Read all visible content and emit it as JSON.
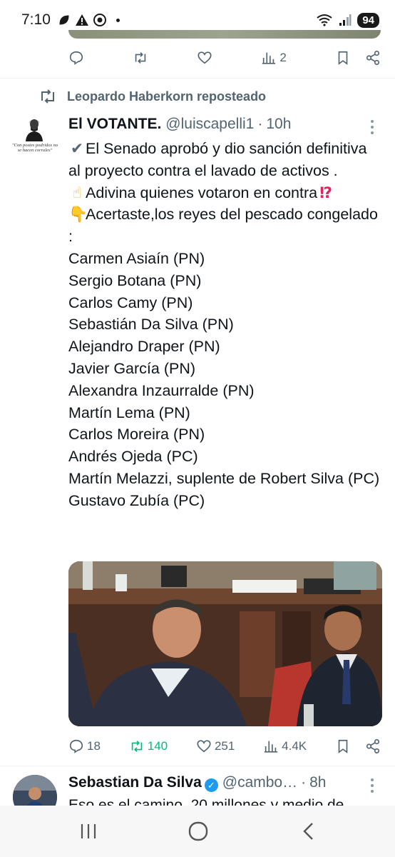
{
  "status_bar": {
    "time": "7:10",
    "battery": "94"
  },
  "prev_tweet_actions": {
    "views": "2"
  },
  "repost": {
    "label": "Leopardo Haberkorn reposteado"
  },
  "avatar_caption": "\"Con postes podridos no se hacen corrales\"",
  "tweet": {
    "author": "El VOTANTE.",
    "handle": "@luiscapelli1",
    "separator": "·",
    "time": "10h",
    "line1_emoji": "✔",
    "line1": "El Senado aprobó y dio sanción definitiva al proyecto contra el lavado de activos .",
    "line2_emoji": "☝",
    "line2": "Adivina quienes votaron en contra",
    "line2_end_emoji": "⁉",
    "line3_emoji": "👇",
    "line3": "Acertaste,los reyes del pescado congelado :",
    "names": [
      "Carmen Asiaín (PN)",
      "Sergio Botana (PN)",
      "Carlos Camy (PN)",
      "Sebastián Da Silva (PN)",
      "Alejandro Draper (PN)",
      "Javier García (PN)",
      "Alexandra Inzaurralde (PN)",
      "Martín Lema (PN)",
      "Carlos Moreira (PN)",
      "Andrés Ojeda (PC)",
      "Martín Melazzi, suplente de Robert Silva (PC)",
      "Gustavo Zubía (PC)"
    ],
    "actions": {
      "replies": "18",
      "reposts": "140",
      "likes": "251",
      "views": "4.4K"
    }
  },
  "next_tweet": {
    "author": "Sebastian Da Silva",
    "handle": "@cambo…",
    "separator": "·",
    "time": "8h",
    "text_cut": "Eso es el camino. 20 millones y medio de"
  },
  "colors": {
    "text": "#0f1419",
    "secondary": "#536471",
    "repost_green": "#00ba7c",
    "verified_blue": "#1d9bf0"
  }
}
